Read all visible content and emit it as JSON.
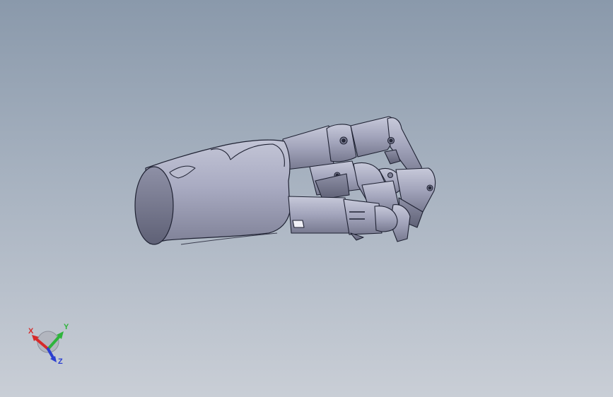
{
  "viewport": {
    "background_top": "#8a99ab",
    "background_bottom": "#c9ced6",
    "model_color": "#a9abc2",
    "edge_color": "#1f2233"
  },
  "triad": {
    "x_label": "X",
    "y_label": "Y",
    "z_label": "Z",
    "x_color": "#d62a2a",
    "y_color": "#2fb43c",
    "z_color": "#2b3fd0"
  }
}
